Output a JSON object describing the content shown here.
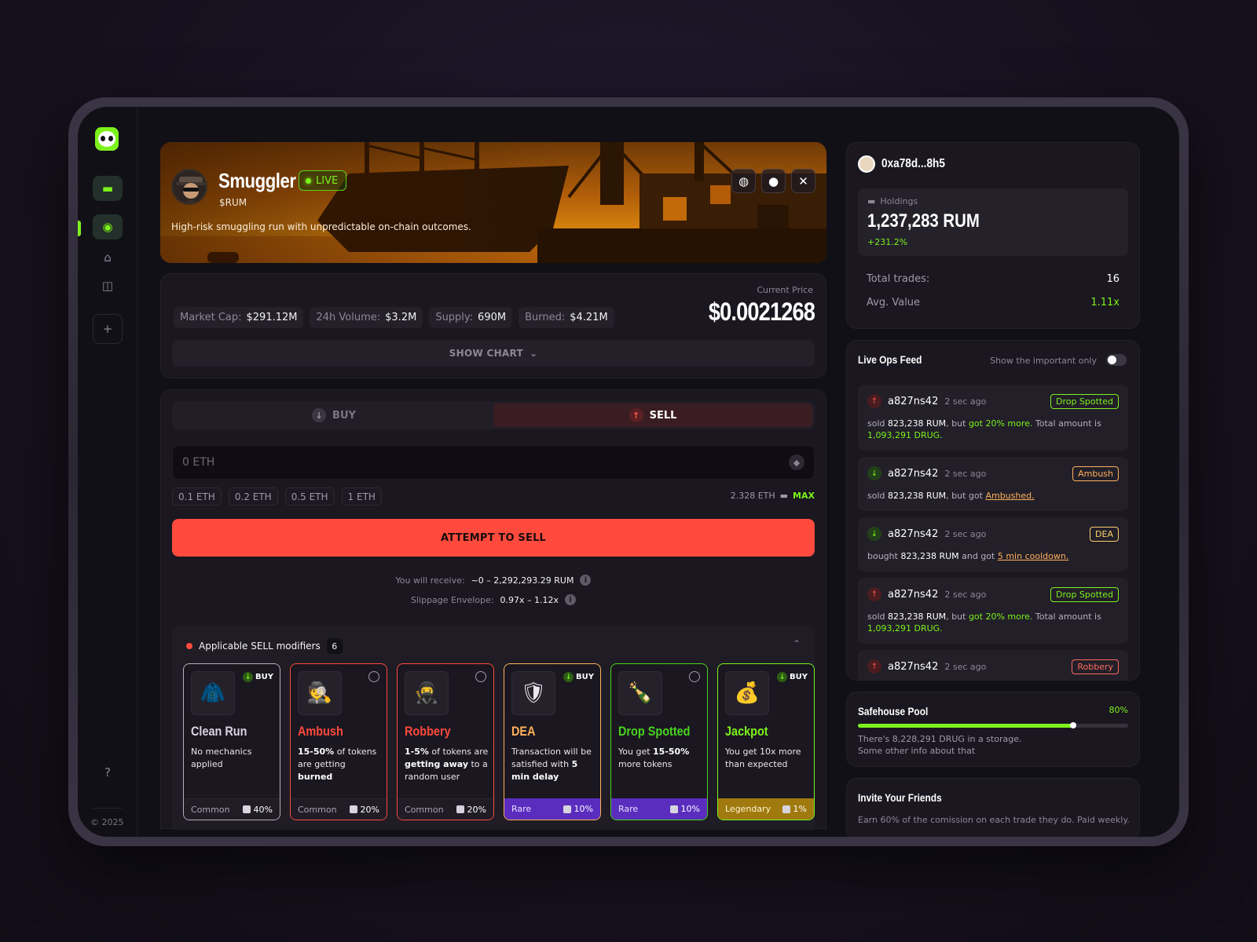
{
  "footer": {
    "copyright": "© 2025"
  },
  "hero": {
    "title": "Smuggler",
    "live_label": "LIVE",
    "ticker": "$RUM",
    "description": "High-risk smuggling run with unpredictable on-chain outcomes."
  },
  "stats": {
    "chips": [
      {
        "label": "Market Cap:",
        "value": "$291.12M"
      },
      {
        "label": "24h Volume:",
        "value": "$3.2M"
      },
      {
        "label": "Supply:",
        "value": "690M"
      },
      {
        "label": "Burned:",
        "value": "$4.21M"
      }
    ],
    "price_label": "Current Price",
    "price_value": "$0.0021268",
    "show_chart_label": "SHOW CHART"
  },
  "trade": {
    "tab_buy": "BUY",
    "tab_sell": "SELL",
    "input_placeholder": "0 ETH",
    "presets": [
      "0.1 ETH",
      "0.2 ETH",
      "0.5 ETH",
      "1 ETH"
    ],
    "balance": "2.328 ETH",
    "max_label": "MAX",
    "attempt_label": "ATTEMPT TO SELL",
    "receive_label": "You will receive:",
    "receive_value": "~0 – 2,292,293.29 RUM",
    "slippage_label": "Slippage Envelope:",
    "slippage_value": "0.97x – 1.12x"
  },
  "modifiers": {
    "title": "Applicable SELL modifiers",
    "count": "6",
    "cards": [
      {
        "name": "Clean Run",
        "color": "#b5b1bd",
        "tag": "BUY",
        "desc_html": "No mechanics applied",
        "rarity": "Common",
        "chance": "40%"
      },
      {
        "name": "Ambush",
        "color": "#ff4a3d",
        "tag": "",
        "desc_html": "<b>15-50%</b> of tokens are getting <b>burned</b>",
        "rarity": "Common",
        "chance": "20%"
      },
      {
        "name": "Robbery",
        "color": "#ff4a3d",
        "tag": "",
        "desc_html": "<b>1-5%</b> of tokens are <b>getting away</b> to a random user",
        "rarity": "Common",
        "chance": "20%"
      },
      {
        "name": "DEA",
        "color": "#ffb15a",
        "tag": "BUY",
        "desc_html": "Transaction will be satisfied with <b>5 min delay</b>",
        "rarity": "Rare",
        "chance": "10%"
      },
      {
        "name": "Drop Spotted",
        "color": "#49d41f",
        "tag": "",
        "desc_html": "You get <b>15-50%</b> more tokens",
        "rarity": "Rare",
        "chance": "10%"
      },
      {
        "name": "Jackpot",
        "color": "#7cf21c",
        "tag": "BUY",
        "desc_html": "You get 10x more than expected",
        "rarity": "Legendary",
        "chance": "1%"
      }
    ]
  },
  "profile": {
    "name": "0xa78d...8h5",
    "holdings_label": "Holdings",
    "holdings_value": "1,237,283 RUM",
    "holdings_change": "+231.2%",
    "total_trades_label": "Total trades:",
    "total_trades_value": "16",
    "avg_value_label": "Avg. Value",
    "avg_value_value": "1.11x"
  },
  "feed": {
    "title": "Live Ops Feed",
    "toggle_label": "Show the important only",
    "items": [
      {
        "dir": "up",
        "user": "a827ns42",
        "time": "2 sec ago",
        "badge": "Drop Spotted",
        "badge_color": "green",
        "body_html": "sold <span class='w'>823,238 RUM</span>, but <span class='g'>got 20% more.</span> Total amount is <span class='g'>1,093,291 DRUG.</span>"
      },
      {
        "dir": "down",
        "user": "a827ns42",
        "time": "2 sec ago",
        "badge": "Ambush",
        "badge_color": "orange",
        "body_html": "sold <span class='w'>823,238 RUM</span>, but got <span class='o'>Ambushed.</span>"
      },
      {
        "dir": "down",
        "user": "a827ns42",
        "time": "2 sec ago",
        "badge": "DEA",
        "badge_color": "yellow",
        "body_html": "bought <span class='w'>823,238 RUM</span> and got <span class='o'>5 min cooldown.</span>"
      },
      {
        "dir": "up",
        "user": "a827ns42",
        "time": "2 sec ago",
        "badge": "Drop Spotted",
        "badge_color": "green",
        "body_html": "sold <span class='w'>823,238 RUM</span>, but <span class='g'>got 20% more.</span> Total amount is <span class='g'>1,093,291 DRUG.</span>"
      },
      {
        "dir": "up",
        "user": "a827ns42",
        "time": "2 sec ago",
        "badge": "Robbery",
        "badge_color": "red",
        "body_html": ""
      }
    ]
  },
  "pool": {
    "title": "Safehouse Pool",
    "percent_label": "80%",
    "fill_fraction": 0.8,
    "desc_line1": "There's 8,228,291 DRUG in a storage.",
    "desc_line2": "Some other info about that"
  },
  "invite": {
    "title": "Invite Your Friends",
    "desc": "Earn 60% of the comission on each trade they do. Paid weekly."
  }
}
